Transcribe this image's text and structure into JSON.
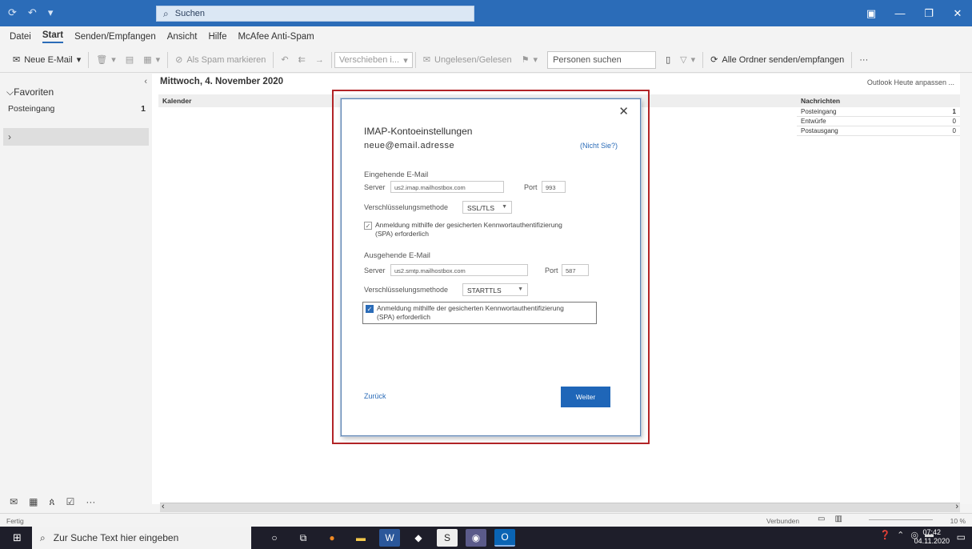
{
  "titlebar": {
    "search_placeholder": "Suchen"
  },
  "menu": {
    "tabs": [
      "Datei",
      "Start",
      "Senden/Empfangen",
      "Ansicht",
      "Hilfe",
      "McAfee Anti-Spam"
    ]
  },
  "ribbon": {
    "new_email": "Neue E-Mail",
    "spam": "Als Spam markieren",
    "move": "Verschieben i...",
    "unread_read": "Ungelesen/Gelesen",
    "people_search": "Personen suchen",
    "send_receive_all": "Alle Ordner senden/empfangen"
  },
  "leftnav": {
    "favorites": "Favoriten",
    "inbox_label": "Posteingang",
    "inbox_count": "1"
  },
  "main": {
    "date": "Mittwoch, 4. November 2020",
    "customize": "Outlook Heute anpassen ...",
    "calendar_header": "Kalender",
    "messages_header": "Nachrichten",
    "messages": [
      {
        "label": "Posteingang",
        "count": "1"
      },
      {
        "label": "Entwürfe",
        "count": "0"
      },
      {
        "label": "Postausgang",
        "count": "0"
      }
    ]
  },
  "dialog": {
    "title": "IMAP-Kontoeinstellungen",
    "email": "neue@email.adresse",
    "not_you": "(Nicht Sie?)",
    "incoming": {
      "heading": "Eingehende E-Mail",
      "server_label": "Server",
      "server_value": "us2.imap.mailhostbox.com",
      "port_label": "Port",
      "port_value": "993",
      "enc_label": "Verschlüsselungsmethode",
      "enc_value": "SSL/TLS",
      "spa_line1": "Anmeldung mithilfe der gesicherten Kennwortauthentifizierung",
      "spa_line2": "(SPA) erforderlich",
      "spa_checked": false
    },
    "outgoing": {
      "heading": "Ausgehende E-Mail",
      "server_label": "Server",
      "server_value": "us2.smtp.mailhostbox.com",
      "port_label": "Port",
      "port_value": "587",
      "enc_label": "Verschlüsselungsmethode",
      "enc_value": "STARTTLS",
      "spa_line1": "Anmeldung mithilfe der gesicherten Kennwortauthentifizierung",
      "spa_line2": "(SPA) erforderlich",
      "spa_checked": true
    },
    "back": "Zurück",
    "next": "Weiter"
  },
  "statusbar": {
    "ready": "Fertig",
    "connected": "Verbunden",
    "zoom": "10 %"
  },
  "taskbar": {
    "search_placeholder": "Zur Suche Text hier eingeben",
    "time": "07:42",
    "date": "04.11.2020"
  },
  "colors": {
    "accent": "#2b6cb8",
    "highlight_frame": "#b22427",
    "primary_button": "#1f66b8"
  }
}
